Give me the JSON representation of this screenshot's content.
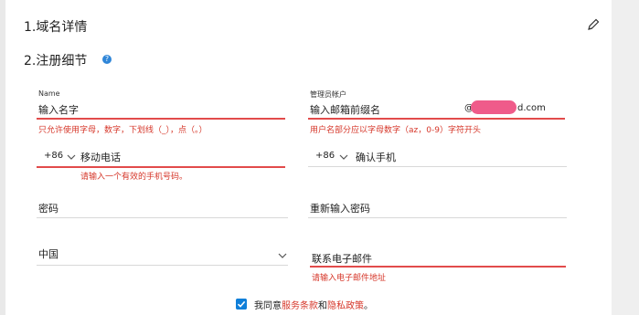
{
  "sections": {
    "section1": "1.域名详情",
    "section2": "2.注册细节"
  },
  "help_icon_symbol": "?",
  "form": {
    "name": {
      "label": "Name",
      "value": "输入名字",
      "error": "只允许使用字母，数字，下划线（_），点（。）"
    },
    "admin_account": {
      "label": "管理员帐户",
      "value": "输入邮箱前缀名",
      "domain_at": "@",
      "domain_suffix": "d.com",
      "error": "用户名部分应以字母数字（az，0-9）字符开头"
    },
    "mobile": {
      "prefix": "+86",
      "value": "移动电话",
      "error": "请输入一个有效的手机号码。"
    },
    "confirm_mobile": {
      "prefix": "+86",
      "value": "确认手机"
    },
    "password": {
      "value": "密码"
    },
    "confirm_password": {
      "value": "重新输入密码"
    },
    "country": {
      "value": "中国"
    },
    "contact_email": {
      "value": "联系电子邮件",
      "error": "请输入电子邮件地址"
    }
  },
  "agreement": {
    "prefix": "我同意",
    "terms": "服务条款",
    "and": "和",
    "privacy": "隐私政策",
    "suffix": "。",
    "checked": true
  },
  "colors": {
    "error": "#d6372a",
    "checkbox": "#0f7fd9",
    "redacted": "#ef5b8a"
  },
  "icons": [
    "edit-pencil-icon",
    "help-icon",
    "chevron-down-icon",
    "checkbox-checked-icon"
  ]
}
